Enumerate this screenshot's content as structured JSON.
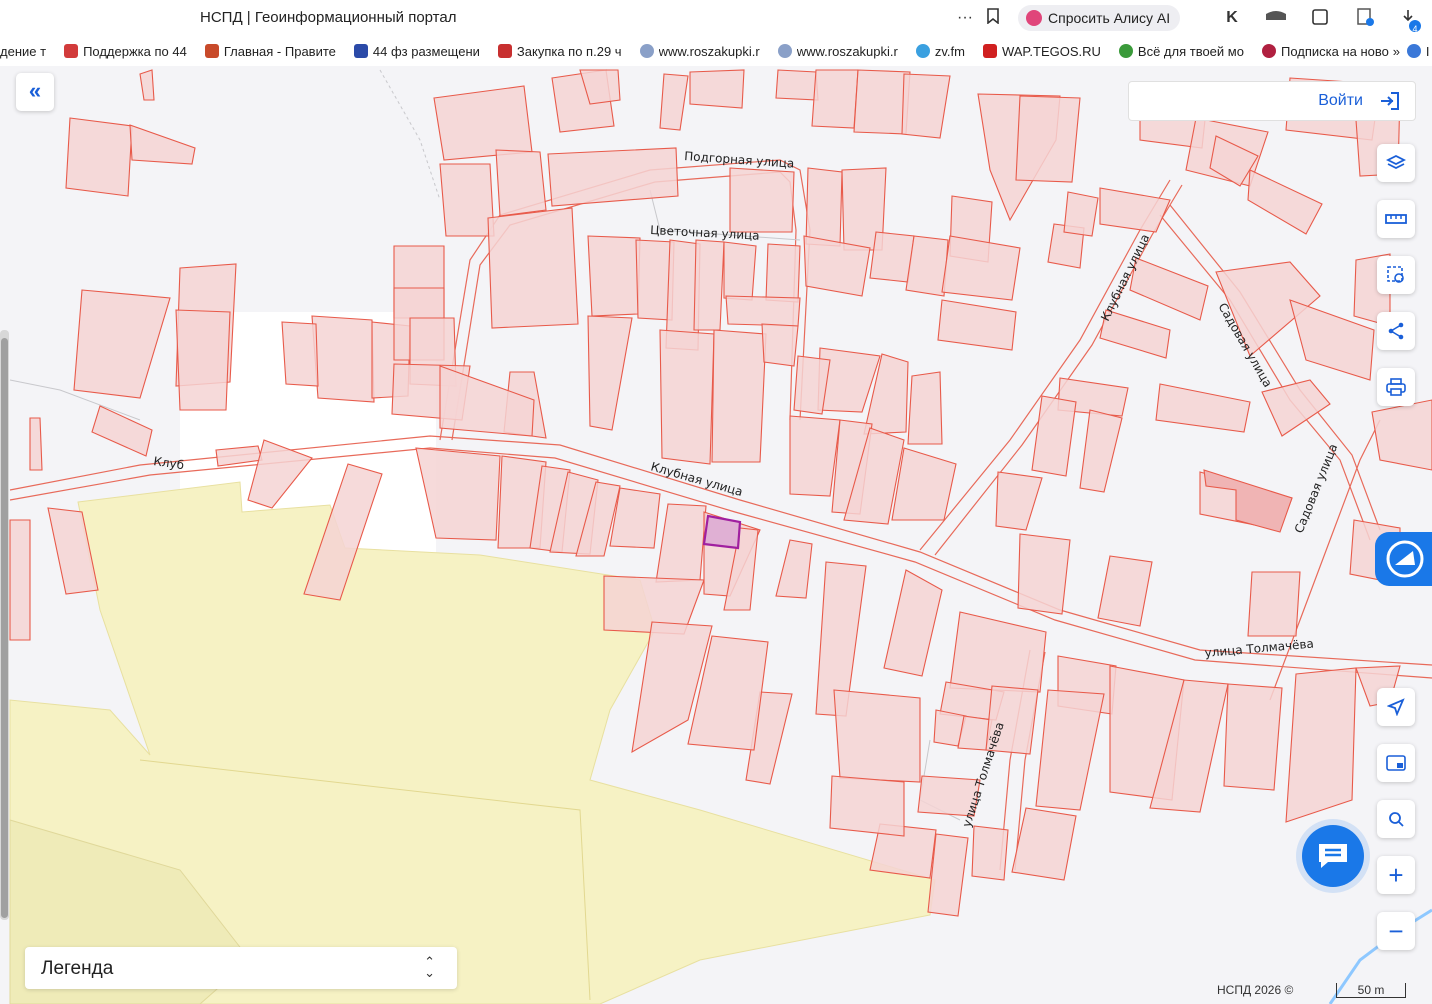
{
  "browser": {
    "tab_title": "НСПД | Геоинформационный портал",
    "alice_button": "Спросить Алису AI",
    "badge_count": "4"
  },
  "bookmarks": [
    {
      "label": "дение т",
      "color": "#888"
    },
    {
      "label": "Поддержка по 44",
      "color": "#d23b3b"
    },
    {
      "label": "Главная - Правите",
      "color": "#c84a2a"
    },
    {
      "label": "44 фз размещени",
      "color": "#2b4aa8"
    },
    {
      "label": "Закупка по п.29 ч",
      "color": "#c83030"
    },
    {
      "label": "www.roszakupki.r",
      "color": "#8aa0c8"
    },
    {
      "label": "www.roszakupki.r",
      "color": "#8aa0c8"
    },
    {
      "label": "zv.fm",
      "color": "#3aa0e0"
    },
    {
      "label": "WAP.TEGOS.RU",
      "color": "#d02020"
    },
    {
      "label": "Всё для твоей мо",
      "color": "#3a9a3a"
    },
    {
      "label": "Подписка на ново",
      "color": "#b02040"
    },
    {
      "label": "I",
      "color": "#3a78d8"
    }
  ],
  "map": {
    "login_label": "Войти",
    "legend_label": "Легенда",
    "copyright": "НСПД 2026 ©",
    "scale": "50 m",
    "streets": [
      {
        "name": "Подгорная улица"
      },
      {
        "name": "Цветочная улица"
      },
      {
        "name": "Клубная улица"
      },
      {
        "name": "Клубная улица"
      },
      {
        "name": "Клуб"
      },
      {
        "name": "Садовая улица"
      },
      {
        "name": "Садовая улица"
      },
      {
        "name": "улица Толмачёва"
      },
      {
        "name": "улица Толмачёва"
      }
    ],
    "colors": {
      "parcel_fill": "#f5d4d4",
      "parcel_stroke": "#e85a4a",
      "zone_fill": "#f6f2c4",
      "selected_stroke": "#a020a0",
      "accent": "#1a78e8"
    }
  },
  "controls": {
    "layers_icon": "layers-icon",
    "ruler_icon": "ruler-icon",
    "select_icon": "area-select-icon",
    "share_icon": "share-icon",
    "print_icon": "print-icon",
    "locate_icon": "navigate-icon",
    "minimap_icon": "minimap-icon",
    "search_point_icon": "search-location-icon",
    "zoom_in": "+",
    "zoom_out": "−"
  }
}
